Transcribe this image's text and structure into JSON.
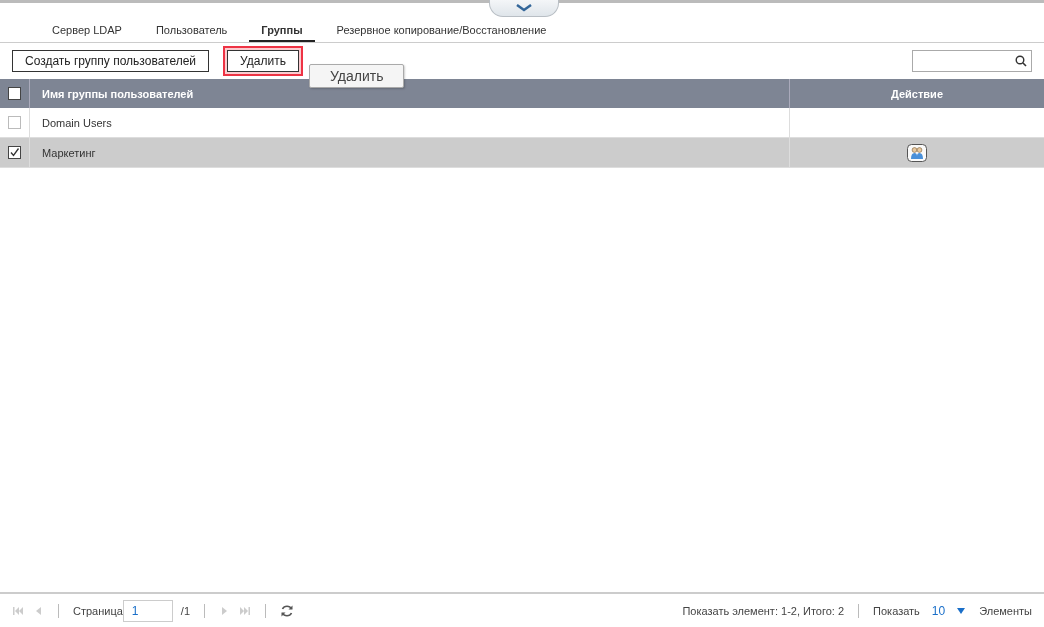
{
  "tabs": [
    {
      "label": "Сервер LDAP",
      "selected": false
    },
    {
      "label": "Пользователь",
      "selected": false
    },
    {
      "label": "Группы",
      "selected": true
    },
    {
      "label": "Резервное копирование/Восстановление",
      "selected": false
    }
  ],
  "toolbar": {
    "buttons": [
      {
        "label": "Создать группу пользователей",
        "highlighted": false
      },
      {
        "label": "Удалить",
        "highlighted": true
      }
    ],
    "tooltip": "Удалить"
  },
  "table": {
    "select_all_checked": false,
    "columns": [
      "Имя группы пользователей",
      "Действие"
    ],
    "rows": [
      {
        "name": "Domain Users",
        "checked": false,
        "selected": false,
        "has_action": false
      },
      {
        "name": "Маркетинг",
        "checked": true,
        "selected": true,
        "has_action": true
      }
    ]
  },
  "pager": {
    "page_label": "Страница",
    "page": "1",
    "total_pages": "/1",
    "summary": "Показать элемент: 1-2, Итого: 2",
    "show_label": "Показать",
    "per_page": "10",
    "items_label": "Элементы"
  }
}
